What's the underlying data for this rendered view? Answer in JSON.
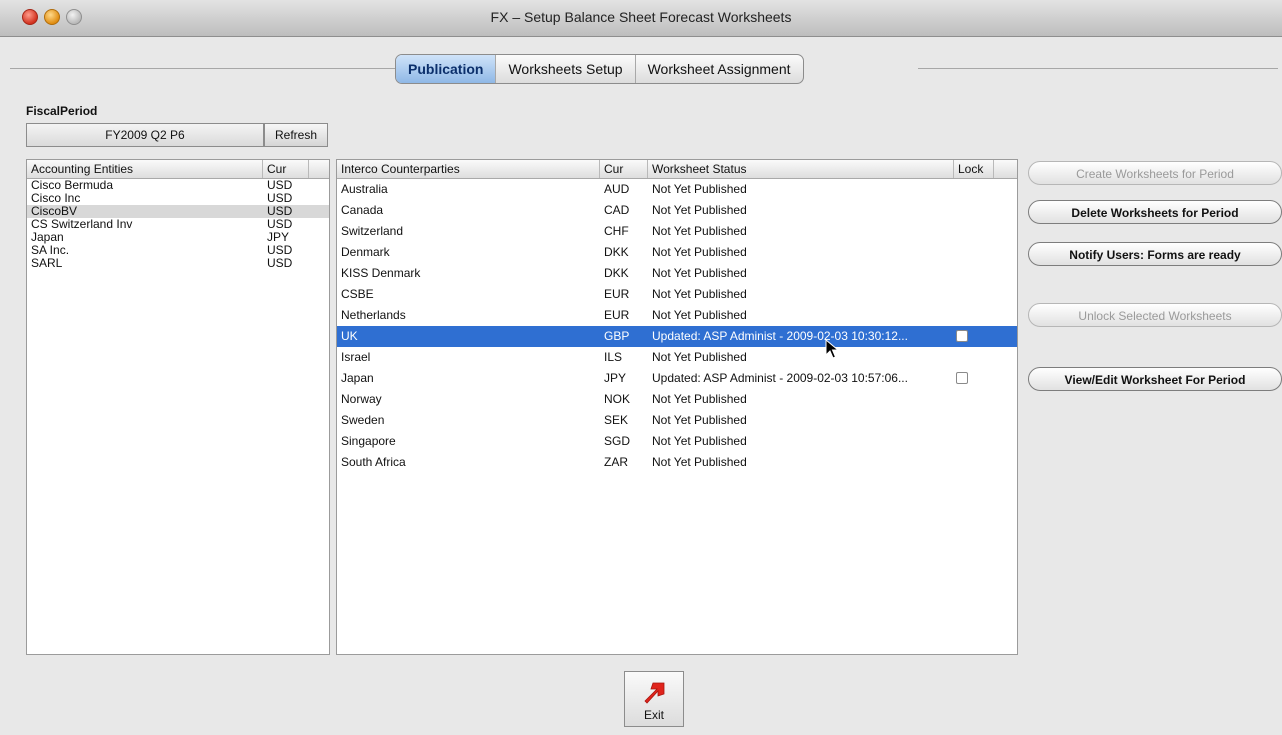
{
  "window": {
    "title": "FX – Setup Balance Sheet Forecast Worksheets"
  },
  "tabs": [
    {
      "label": "Publication",
      "active": true
    },
    {
      "label": "Worksheets Setup",
      "active": false
    },
    {
      "label": "Worksheet Assignment",
      "active": false
    }
  ],
  "fiscal": {
    "label": "FiscalPeriod",
    "value": "FY2009 Q2 P6",
    "refresh_label": "Refresh"
  },
  "entities": {
    "headers": {
      "name": "Accounting Entities",
      "cur": "Cur"
    },
    "rows": [
      {
        "name": "Cisco Bermuda",
        "cur": "USD"
      },
      {
        "name": "Cisco Inc",
        "cur": "USD"
      },
      {
        "name": "CiscoBV",
        "cur": "USD",
        "selected": true
      },
      {
        "name": "CS Switzerland Inv",
        "cur": "USD"
      },
      {
        "name": "Japan",
        "cur": "JPY"
      },
      {
        "name": "SA Inc.",
        "cur": "USD"
      },
      {
        "name": "SARL",
        "cur": "USD"
      }
    ]
  },
  "counterparties": {
    "headers": {
      "name": "Interco Counterparties",
      "cur": "Cur",
      "status": "Worksheet Status",
      "lock": "Lock"
    },
    "rows": [
      {
        "name": "Australia",
        "cur": "AUD",
        "status": "Not Yet Published"
      },
      {
        "name": "Canada",
        "cur": "CAD",
        "status": "Not Yet Published"
      },
      {
        "name": "Switzerland",
        "cur": "CHF",
        "status": "Not Yet Published"
      },
      {
        "name": "Denmark",
        "cur": "DKK",
        "status": "Not Yet Published"
      },
      {
        "name": "KISS Denmark",
        "cur": "DKK",
        "status": "Not Yet Published"
      },
      {
        "name": "CSBE",
        "cur": "EUR",
        "status": "Not Yet Published"
      },
      {
        "name": "Netherlands",
        "cur": "EUR",
        "status": "Not Yet Published"
      },
      {
        "name": "UK",
        "cur": "GBP",
        "status": "Updated: ASP Administ - 2009-02-03 10:30:12...",
        "lock": true,
        "selected": true
      },
      {
        "name": "Israel",
        "cur": "ILS",
        "status": "Not Yet Published"
      },
      {
        "name": "Japan",
        "cur": "JPY",
        "status": "Updated: ASP Administ - 2009-02-03 10:57:06...",
        "lock": true
      },
      {
        "name": "Norway",
        "cur": "NOK",
        "status": "Not Yet Published"
      },
      {
        "name": "Sweden",
        "cur": "SEK",
        "status": "Not Yet Published"
      },
      {
        "name": "Singapore",
        "cur": "SGD",
        "status": "Not Yet Published"
      },
      {
        "name": "South Africa",
        "cur": "ZAR",
        "status": "Not Yet Published"
      }
    ]
  },
  "actions": [
    {
      "label": "Create Worksheets for Period",
      "enabled": false
    },
    {
      "label": "Delete Worksheets for Period",
      "enabled": true
    },
    {
      "label": "Notify Users: Forms are ready",
      "enabled": true
    },
    {
      "label": "Unlock Selected Worksheets",
      "enabled": false
    },
    {
      "label": "View/Edit  Worksheet For Period",
      "enabled": true
    }
  ],
  "exit": {
    "label": "Exit",
    "icon": "red-arrow-icon",
    "color": "#e0241c"
  }
}
